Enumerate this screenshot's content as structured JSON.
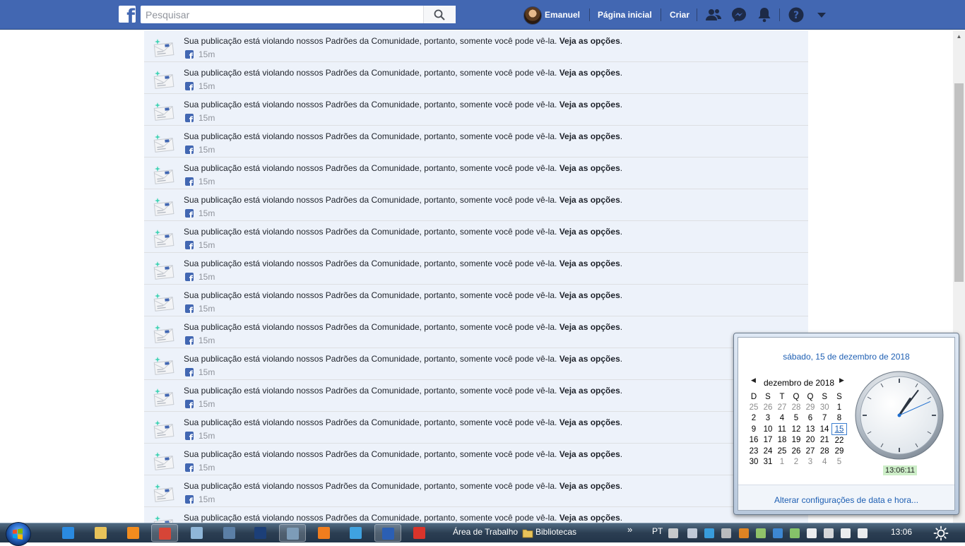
{
  "topbar": {
    "logo": "f",
    "search_placeholder": "Pesquisar",
    "search_icon": "search-icon",
    "user_name": "Emanuel",
    "home_label": "Página inicial",
    "create_label": "Criar",
    "icons": [
      "friend-requests-icon",
      "messenger-icon",
      "notifications-bell-icon",
      "help-icon",
      "dropdown-caret-icon"
    ],
    "colors": {
      "bar": "#4267b2",
      "text": "#ffffff"
    }
  },
  "notifications": {
    "message": "Sua publicação está violando nossos Padrões da Comunidade, portanto, somente você pode vê-la.",
    "link": "Veja as opções",
    "after_link": ".",
    "time": "15m",
    "thumb_icon": "community-standards-envelope-icon",
    "source_icon": "facebook-icon",
    "count": 16,
    "background": "#edf2fa"
  },
  "clock_popup": {
    "long_date": "sábado, 15 de dezembro de 2018",
    "month_title": "dezembro de 2018",
    "prev_icon": "chevron-left-icon",
    "next_icon": "chevron-right-icon",
    "weekdays": [
      "D",
      "S",
      "T",
      "Q",
      "Q",
      "S",
      "S"
    ],
    "weeks": [
      [
        "25",
        "26",
        "27",
        "28",
        "29",
        "30",
        "1"
      ],
      [
        "2",
        "3",
        "4",
        "5",
        "6",
        "7",
        "8"
      ],
      [
        "9",
        "10",
        "11",
        "12",
        "13",
        "14",
        "15"
      ],
      [
        "16",
        "17",
        "18",
        "19",
        "20",
        "21",
        "22"
      ],
      [
        "23",
        "24",
        "25",
        "26",
        "27",
        "28",
        "29"
      ],
      [
        "30",
        "31",
        "1",
        "2",
        "3",
        "4",
        "5"
      ]
    ],
    "today": "15",
    "digital_time": "13:06:11",
    "analog_time": {
      "hours": 13,
      "minutes": 6,
      "seconds": 11
    },
    "change_settings_link": "Alterar configurações de data e hora..."
  },
  "taskbar": {
    "start_icon": "windows-start-orb-icon",
    "apps": [
      {
        "name": "internet-explorer-icon",
        "color": "#2a8ae0"
      },
      {
        "name": "windows-explorer-icon",
        "color": "#e8c35a"
      },
      {
        "name": "media-player-icon",
        "color": "#f28c1e"
      },
      {
        "name": "chrome-icon",
        "color": "#d64537"
      },
      {
        "name": "calculator-icon",
        "color": "#8fb6d8"
      },
      {
        "name": "on-screen-keyboard-icon",
        "color": "#5b7fa6"
      },
      {
        "name": "photoshop-icon",
        "color": "#1c3f78"
      },
      {
        "name": "snipping-tool-icon",
        "color": "#7d9cb8"
      },
      {
        "name": "avast-icon",
        "color": "#f07d1e"
      },
      {
        "name": "globe-app-icon",
        "color": "#3fa2e0"
      },
      {
        "name": "word-icon",
        "color": "#2b5fb4"
      },
      {
        "name": "acrobat-reader-icon",
        "color": "#d9342b"
      }
    ],
    "desktop_label": "Área de Trabalho",
    "libraries_label": "Bibliotecas",
    "overflow_icon": "chevron-double-right-icon",
    "language": "PT",
    "tray_icons": [
      "keyboard-icon",
      "camera-icon",
      "skype-icon",
      "webcam-icon",
      "avast-tray-icon",
      "network-monitor-icon",
      "bluetooth-icon",
      "safely-remove-icon",
      "flag-action-center-icon",
      "battery-icon",
      "signal-icon",
      "volume-icon"
    ],
    "clock": "13:06",
    "show_desktop_icon": "brightness-icon"
  }
}
